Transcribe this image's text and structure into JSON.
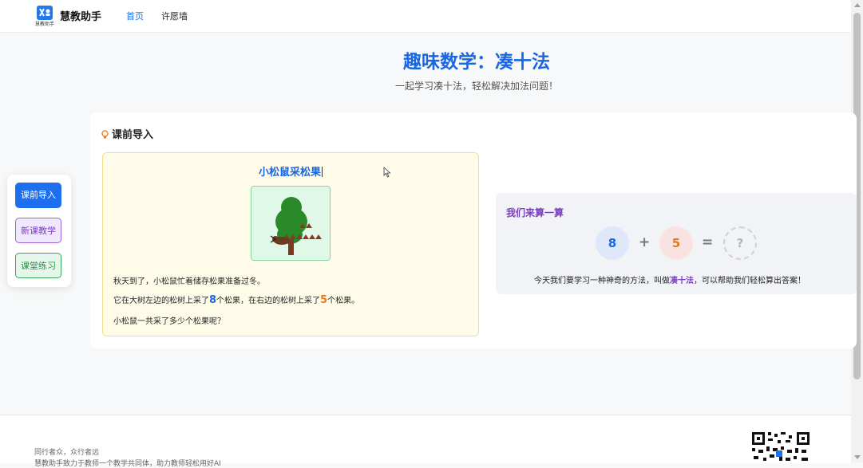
{
  "nav": {
    "logo_icon": "app-logo-icon",
    "logo_small_text": "慧教助手",
    "brand": "慧教助手",
    "links": [
      {
        "label": "首页",
        "active": true
      },
      {
        "label": "许愿墙",
        "active": false
      }
    ]
  },
  "hero": {
    "title": "趣味数学：凑十法",
    "subtitle": "一起学习凑十法，轻松解决加法问题！"
  },
  "side_tabs": [
    {
      "label": "课前导入",
      "state": "active"
    },
    {
      "label": "新课教学",
      "state": "normal"
    },
    {
      "label": "课堂练习",
      "state": "normal"
    }
  ],
  "section": {
    "icon": "lightbulb-icon",
    "title": "课前导入"
  },
  "story": {
    "title": "小松鼠采松果",
    "image_icon": "tree-with-squirrel-illustration",
    "line1": "秋天到了，小松鼠忙着储存松果准备过冬。",
    "line2_a": "它在大树左边的松树上采了",
    "left_count": "8",
    "line2_b": "个松果，在右边的松树上采了",
    "right_count": "5",
    "line2_c": "个松果。",
    "line3": "小松鼠一共采了多少个松果呢？"
  },
  "calc": {
    "title": "我们来算一算",
    "a": "8",
    "op_plus": "+",
    "b": "5",
    "op_eq": "=",
    "result": "?",
    "desc_a": "今天我们要学习一种神奇的方法，叫做",
    "desc_highlight": "凑十法",
    "desc_b": "，可以帮助我们轻松算出答案！"
  },
  "footer": {
    "line1": "同行者众，众行者远",
    "line2": "慧教助手致力于教师一个教学共同体，助力教师轻松用好AI",
    "qr_icon": "qr-code-icon"
  },
  "colors": {
    "primary": "#1a66e3",
    "purple": "#7a3fc0",
    "green": "#2b8d46",
    "orange": "#e07b27",
    "story_bg": "#fefce9"
  }
}
